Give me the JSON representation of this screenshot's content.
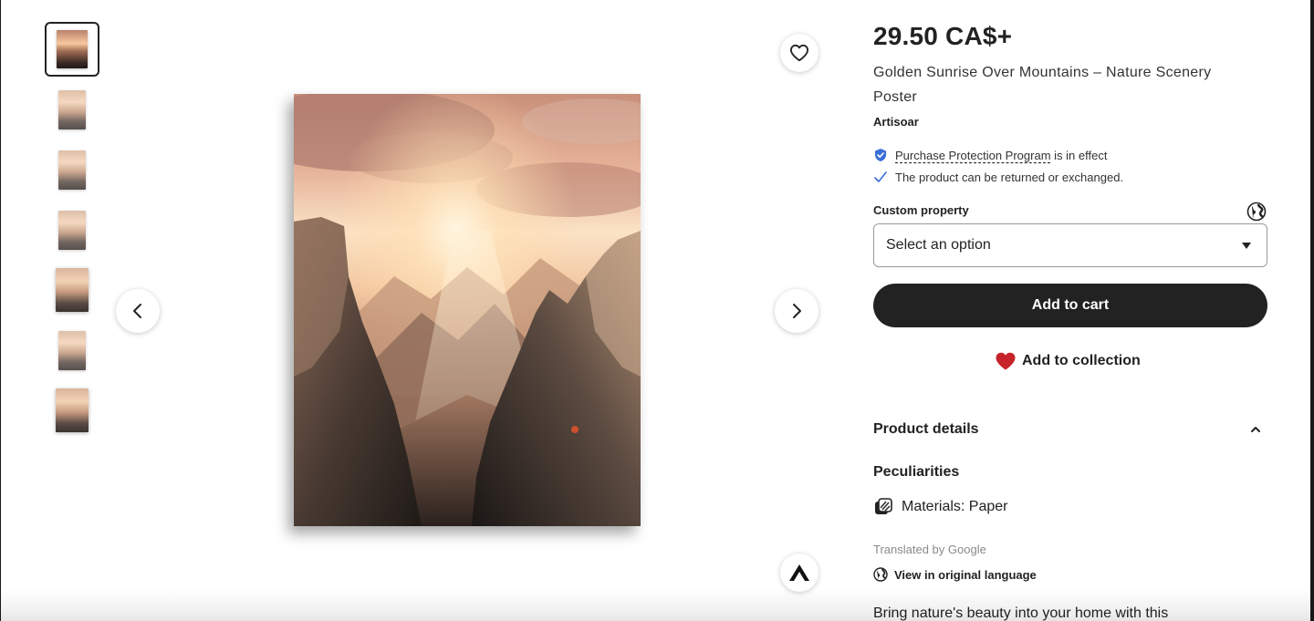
{
  "gallery": {
    "thumbnails_count": 7,
    "active_index": 0
  },
  "product": {
    "price": "29.50 CA$+",
    "title": "Golden Sunrise Over Mountains – Nature Scenery Poster",
    "shop": "Artisoar",
    "protection_link": "Purchase Protection Program",
    "protection_suffix": "is in effect",
    "returns_text": "The product can be returned or exchanged.",
    "custom_property_label": "Custom property",
    "select_placeholder": "Select an option",
    "add_to_cart": "Add to cart",
    "add_to_collection": "Add to collection",
    "details_heading": "Product details",
    "peculiarities_heading": "Peculiarities",
    "materials": "Materials: Paper",
    "translated_by": "Translated by Google",
    "view_original": "View in original language",
    "description_start": "Bring nature's beauty into your home with this"
  },
  "colors": {
    "accent_dark": "#222222",
    "heart_red": "#c7232a",
    "shield_blue": "#3b6fd8",
    "check_blue": "#3b6fd8"
  },
  "icons": [
    "heart-outline-icon",
    "chevron-left-icon",
    "chevron-right-icon",
    "shield-icon",
    "check-icon",
    "globe-icon",
    "caret-down-icon",
    "heart-filled-icon",
    "chevron-up-icon",
    "materials-icon",
    "translate-globe-icon",
    "ar-logo-icon"
  ]
}
